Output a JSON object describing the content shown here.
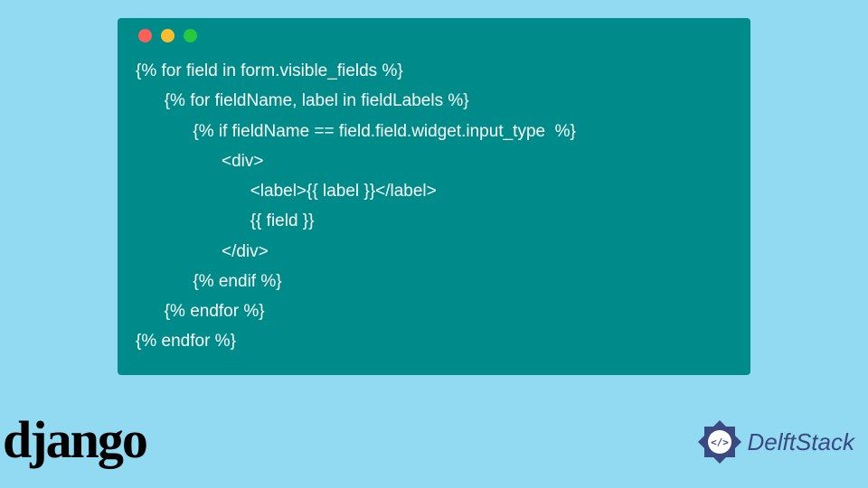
{
  "code": {
    "lines": [
      "{% for field in form.visible_fields %}",
      "      {% for fieldName, label in fieldLabels %}",
      "            {% if fieldName == field.field.widget.input_type  %}",
      "                  <div>",
      "                        <label>{{ label }}</label>",
      "                        {{ field }}",
      "                  </div>",
      "            {% endif %}",
      "      {% endfor %}",
      "{% endfor %}"
    ]
  },
  "logos": {
    "django": "django",
    "delftstack": "DelftStack"
  }
}
